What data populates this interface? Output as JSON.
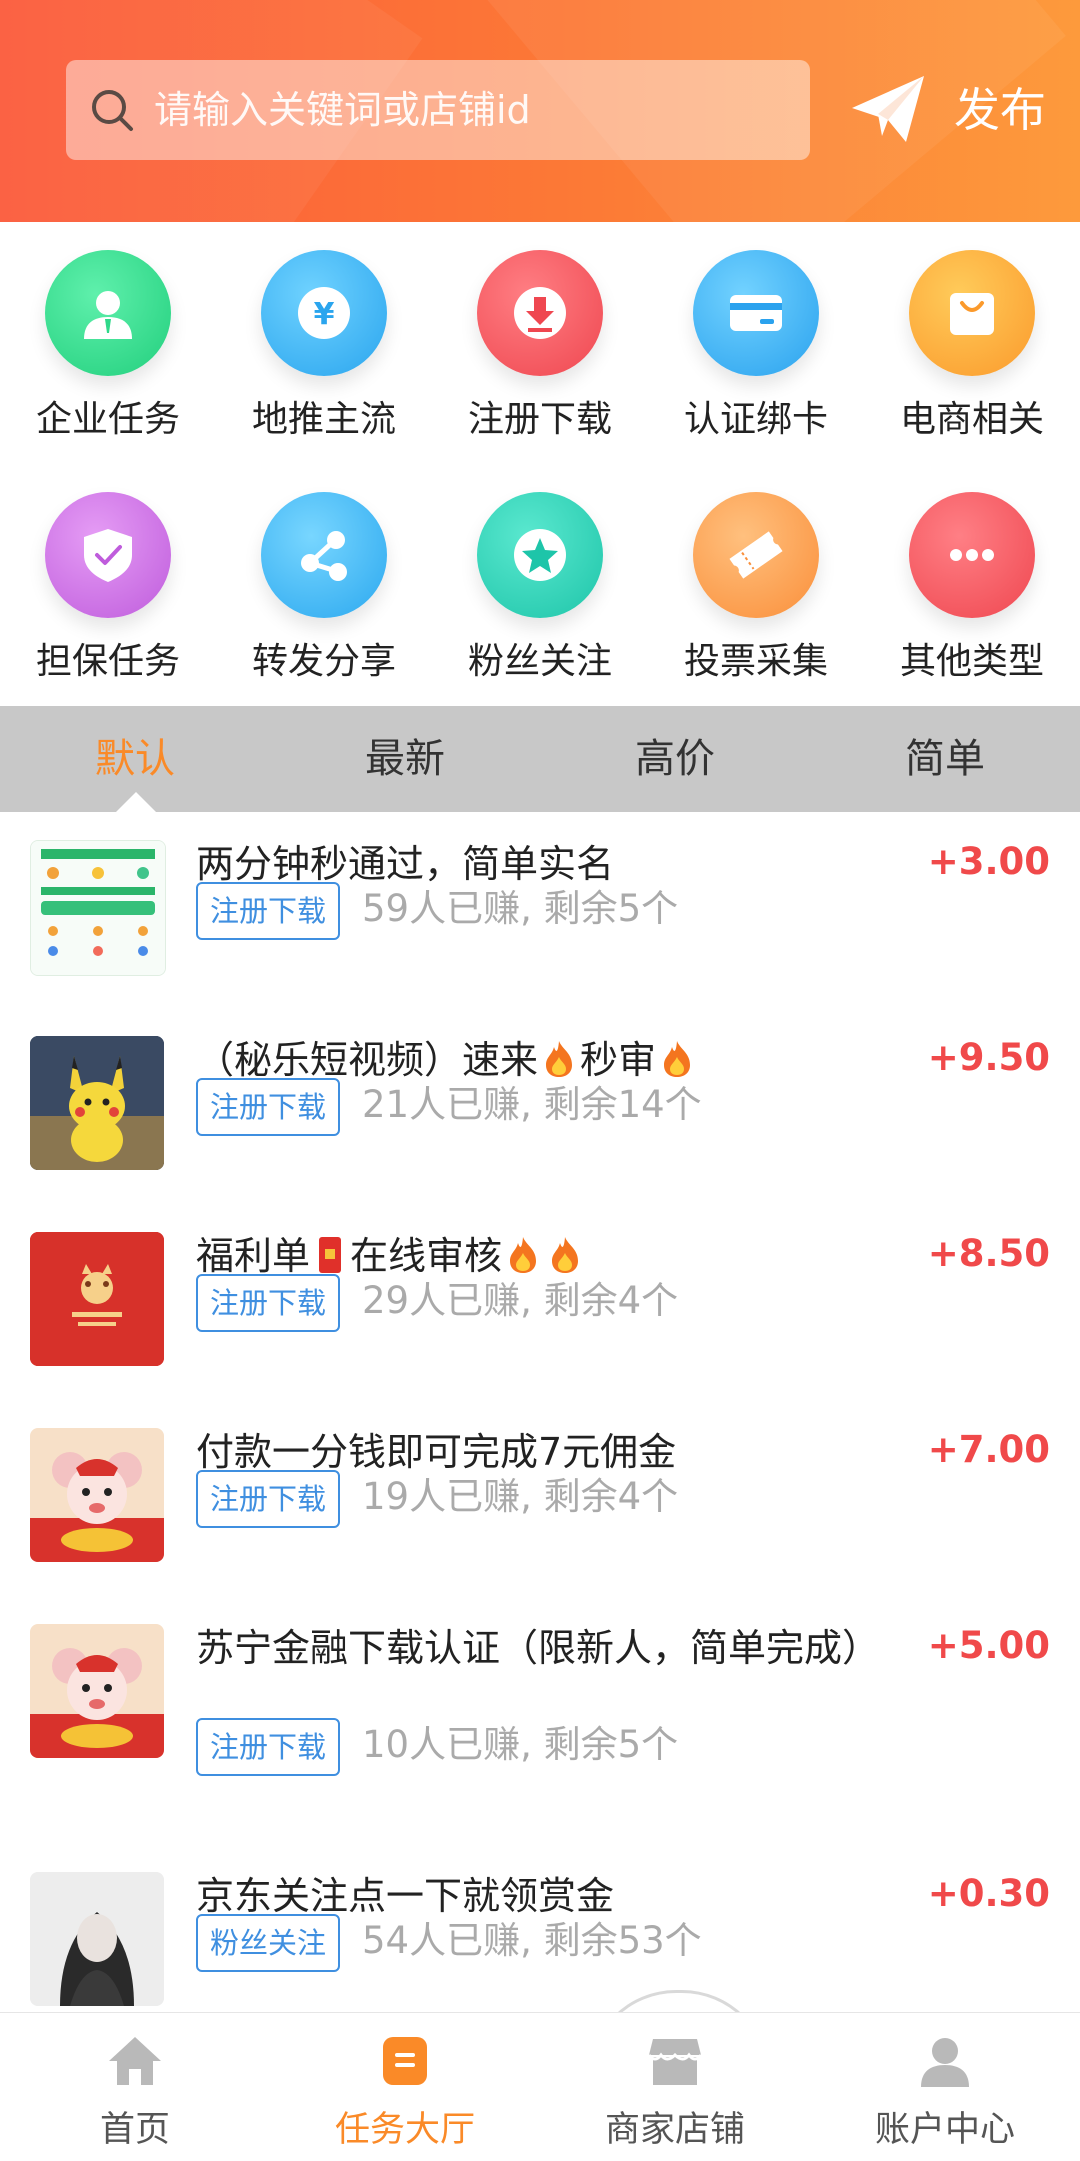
{
  "header": {
    "search_placeholder": "请输入关键词或店铺id",
    "publish_label": "发布",
    "gradient": [
      "#fb5a3a",
      "#fd9a3c"
    ]
  },
  "categories": [
    {
      "label": "企业任务",
      "icon": "user-icon",
      "color": "#2fd98a"
    },
    {
      "label": "地推主流",
      "icon": "yen-icon",
      "color": "#3fb3f2"
    },
    {
      "label": "注册下载",
      "icon": "download-icon",
      "color": "#f5545c"
    },
    {
      "label": "认证绑卡",
      "icon": "card-icon",
      "color": "#3fb0f2"
    },
    {
      "label": "电商相关",
      "icon": "shopping-bag-icon",
      "color": "#fba63a"
    },
    {
      "label": "担保任务",
      "icon": "shield-check-icon",
      "color": "#c86ae0"
    },
    {
      "label": "转发分享",
      "icon": "share-icon",
      "color": "#3fb7f2"
    },
    {
      "label": "粉丝关注",
      "icon": "star-icon",
      "color": "#26cfb4"
    },
    {
      "label": "投票采集",
      "icon": "ticket-icon",
      "color": "#fb9e4a"
    },
    {
      "label": "其他类型",
      "icon": "more-icon",
      "color": "#f5545c"
    }
  ],
  "sort_tabs": [
    "默认",
    "最新",
    "高价",
    "简单"
  ],
  "active_tab": "默认",
  "accent_color": "#fa8a28",
  "price_color": "#f0494a",
  "tasks": [
    {
      "title": "两分钟秒通过，简单实名",
      "price": "+3.00",
      "tag": "注册下载",
      "meta": "59人已赚, 剩余5个"
    },
    {
      "title_parts": [
        "（秘乐短视频）速来",
        "秒审"
      ],
      "price": "+9.50",
      "tag": "注册下载",
      "meta": "21人已赚, 剩余14个"
    },
    {
      "title_parts": [
        "福利单",
        "在线审核"
      ],
      "price": "+8.50",
      "tag": "注册下载",
      "meta": "29人已赚, 剩余4个"
    },
    {
      "title": "付款一分钱即可完成7元佣金",
      "price": "+7.00",
      "tag": "注册下载",
      "meta": "19人已赚, 剩余4个"
    },
    {
      "title": "苏宁金融下载认证（限新人，简单完成）",
      "price": "+5.00",
      "tag": "注册下载",
      "meta": "10人已赚, 剩余5个"
    },
    {
      "title": "京东关注点一下就领赏金",
      "price": "+0.30",
      "tag": "粉丝关注",
      "meta": "54人已赚, 剩余53个"
    }
  ],
  "nav": [
    {
      "label": "首页",
      "icon": "home-icon"
    },
    {
      "label": "任务大厅",
      "icon": "task-hall-icon"
    },
    {
      "label": "商家店铺",
      "icon": "store-icon"
    },
    {
      "label": "账户中心",
      "icon": "account-icon"
    }
  ],
  "active_nav": "任务大厅"
}
